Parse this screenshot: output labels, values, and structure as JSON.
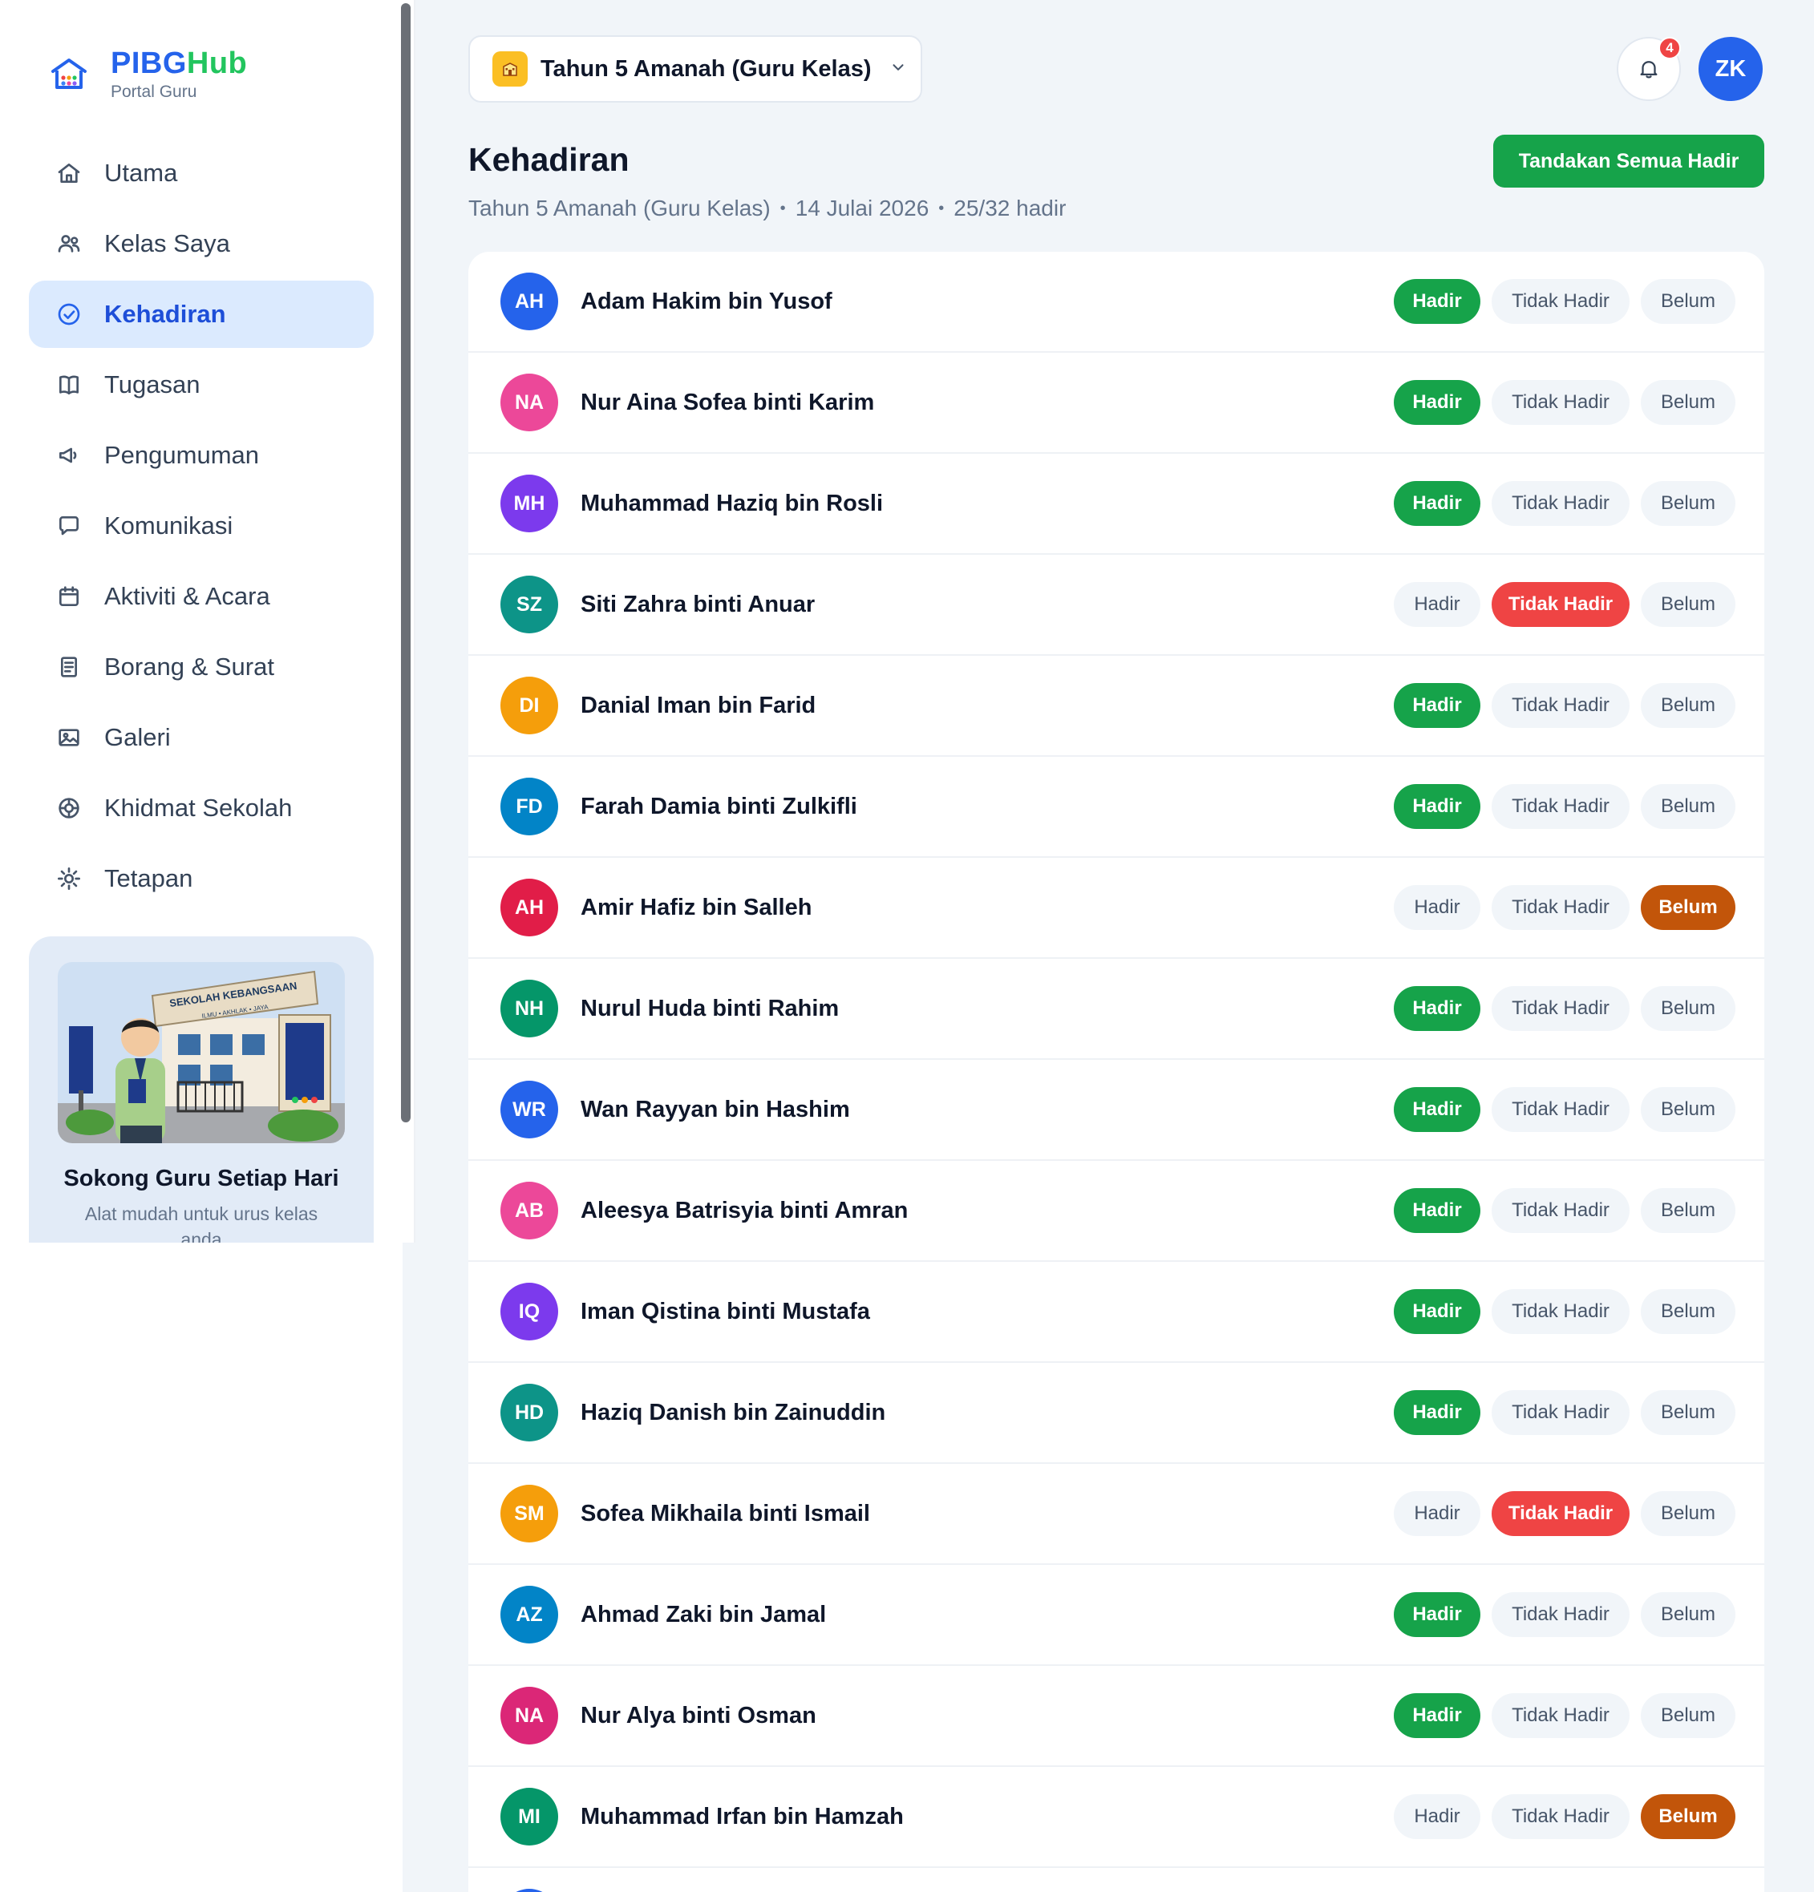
{
  "brand": {
    "name_part1": "PIBG",
    "name_part2": "Hub",
    "subtitle": "Portal Guru"
  },
  "sidebar": {
    "items": [
      {
        "label": "Utama",
        "icon": "home-icon"
      },
      {
        "label": "Kelas Saya",
        "icon": "users-icon"
      },
      {
        "label": "Kehadiran",
        "icon": "check-circle-icon",
        "active": true
      },
      {
        "label": "Tugasan",
        "icon": "book-icon"
      },
      {
        "label": "Pengumuman",
        "icon": "megaphone-icon"
      },
      {
        "label": "Komunikasi",
        "icon": "chat-icon"
      },
      {
        "label": "Aktiviti & Acara",
        "icon": "calendar-icon"
      },
      {
        "label": "Borang & Surat",
        "icon": "document-icon"
      },
      {
        "label": "Galeri",
        "icon": "image-icon"
      },
      {
        "label": "Khidmat Sekolah",
        "icon": "lifebuoy-icon"
      },
      {
        "label": "Tetapan",
        "icon": "gear-icon"
      }
    ],
    "promo": {
      "title": "Sokong Guru Setiap Hari",
      "subtitle": "Alat mudah untuk urus kelas anda",
      "art": {
        "sign_text": "SEKOLAH KEBANGSAAN",
        "sign_sub": "ILMU • AKHLAK • JAYA"
      }
    }
  },
  "header": {
    "class_selector": "Tahun 5 Amanah (Guru Kelas)",
    "notification_count": "4",
    "user_initials": "ZK"
  },
  "page": {
    "title": "Kehadiran",
    "class_name": "Tahun 5 Amanah (Guru Kelas)",
    "date": "14 Julai 2026",
    "summary": "25/32 hadir",
    "mark_all_label": "Tandakan Semua Hadir"
  },
  "status_labels": {
    "present": "Hadir",
    "absent": "Tidak Hadir",
    "pending": "Belum"
  },
  "colors": {
    "accent": "#2563eb",
    "present": "#16a34a",
    "absent": "#ef4444",
    "pending": "#c2550a"
  },
  "students": [
    {
      "initials": "AH",
      "name": "Adam Hakim bin Yusof",
      "status": "present",
      "color": "#2563eb"
    },
    {
      "initials": "NA",
      "name": "Nur Aina Sofea binti Karim",
      "status": "present",
      "color": "#ec4899"
    },
    {
      "initials": "MH",
      "name": "Muhammad Haziq bin Rosli",
      "status": "present",
      "color": "#7c3aed"
    },
    {
      "initials": "SZ",
      "name": "Siti Zahra binti Anuar",
      "status": "absent",
      "color": "#0d9488"
    },
    {
      "initials": "DI",
      "name": "Danial Iman bin Farid",
      "status": "present",
      "color": "#f59e0b"
    },
    {
      "initials": "FD",
      "name": "Farah Damia binti Zulkifli",
      "status": "present",
      "color": "#0284c7"
    },
    {
      "initials": "AH",
      "name": "Amir Hafiz bin Salleh",
      "status": "pending",
      "color": "#e11d48"
    },
    {
      "initials": "NH",
      "name": "Nurul Huda binti Rahim",
      "status": "present",
      "color": "#059669"
    },
    {
      "initials": "WR",
      "name": "Wan Rayyan bin Hashim",
      "status": "present",
      "color": "#2563eb"
    },
    {
      "initials": "AB",
      "name": "Aleesya Batrisyia binti Amran",
      "status": "present",
      "color": "#ec4899"
    },
    {
      "initials": "IQ",
      "name": "Iman Qistina binti Mustafa",
      "status": "present",
      "color": "#7c3aed"
    },
    {
      "initials": "HD",
      "name": "Haziq Danish bin Zainuddin",
      "status": "present",
      "color": "#0d9488"
    },
    {
      "initials": "SM",
      "name": "Sofea Mikhaila binti Ismail",
      "status": "absent",
      "color": "#f59e0b"
    },
    {
      "initials": "AZ",
      "name": "Ahmad Zaki bin Jamal",
      "status": "present",
      "color": "#0284c7"
    },
    {
      "initials": "NA",
      "name": "Nur Alya binti Osman",
      "status": "present",
      "color": "#db2777"
    },
    {
      "initials": "MI",
      "name": "Muhammad Irfan bin Hamzah",
      "status": "pending",
      "color": "#059669"
    },
    {
      "initials": "",
      "name": "",
      "status": "",
      "color": "#2563eb"
    }
  ]
}
